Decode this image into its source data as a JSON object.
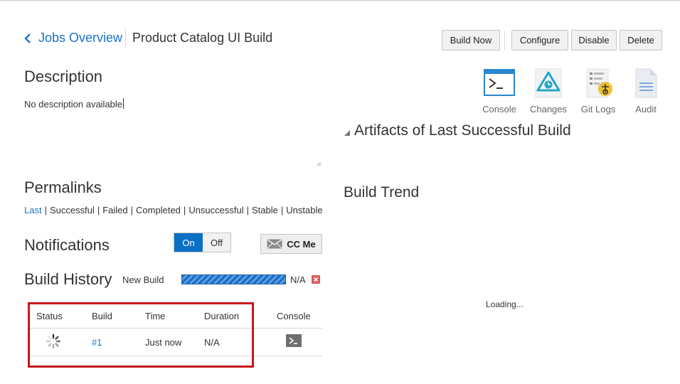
{
  "header": {
    "back_label": "Jobs Overview",
    "job_title": "Product Catalog UI Build"
  },
  "toolbar": {
    "build_now": "Build Now",
    "configure": "Configure",
    "disable": "Disable",
    "delete": "Delete"
  },
  "description": {
    "heading": "Description",
    "text": "No description available"
  },
  "actions": [
    {
      "label": "Console",
      "icon": "console-icon"
    },
    {
      "label": "Changes",
      "icon": "changes-icon"
    },
    {
      "label": "Git Logs",
      "icon": "git-logs-icon"
    },
    {
      "label": "Audit",
      "icon": "audit-icon"
    }
  ],
  "artifacts": {
    "heading": "Artifacts of Last Successful Build",
    "collapsed": true
  },
  "build_trend": {
    "heading": "Build Trend",
    "loading": "Loading..."
  },
  "permalinks": {
    "heading": "Permalinks",
    "links": [
      "Last",
      "Successful",
      "Failed",
      "Completed",
      "Unsuccessful",
      "Stable",
      "Unstable"
    ],
    "separator": "|"
  },
  "notifications": {
    "heading": "Notifications",
    "on_label": "On",
    "off_label": "Off",
    "selected": "On",
    "cc_label": "CC Me"
  },
  "build_history": {
    "heading": "Build History",
    "new_build_label": "New Build",
    "progress_value": "N/A",
    "columns": [
      "Status",
      "Build",
      "Time",
      "Duration",
      "Console"
    ],
    "rows": [
      {
        "status": "in-progress",
        "build": "#1",
        "time": "Just now",
        "duration": "N/A",
        "console": "console-icon"
      }
    ]
  },
  "colors": {
    "accent": "#1a73c9",
    "toggle_on": "#0b70c5",
    "highlight_border": "#c8171c",
    "cancel": "#e05a5a"
  }
}
